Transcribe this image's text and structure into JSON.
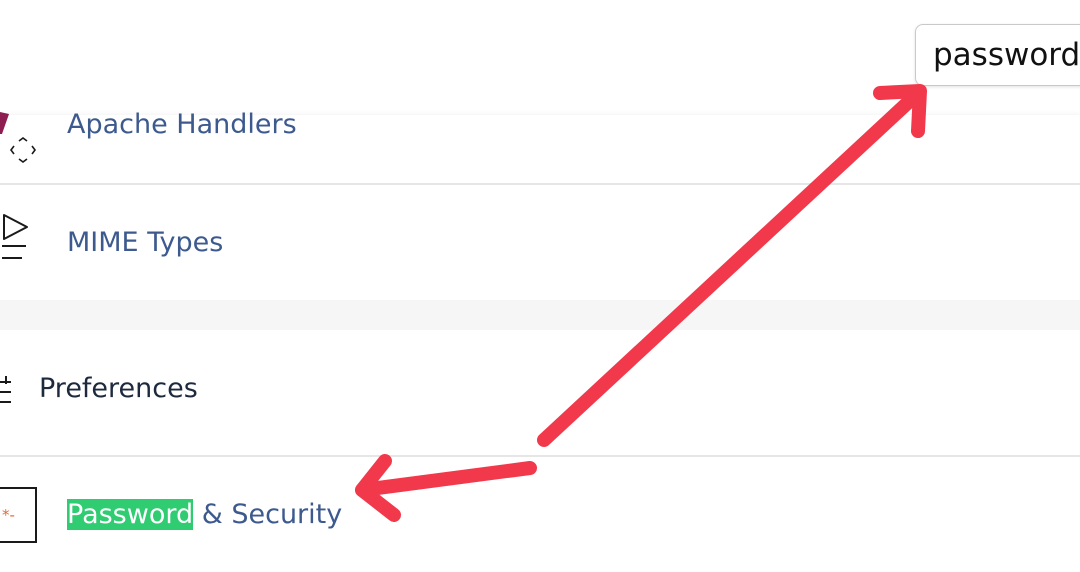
{
  "search": {
    "value": "password"
  },
  "items": {
    "apache_handlers": {
      "label": "Apache Handlers",
      "icon": "apache-handlers-icon"
    },
    "mime_types": {
      "label": "MIME Types",
      "icon": "mime-types-icon"
    }
  },
  "preferences": {
    "heading": "Preferences",
    "icon": "preferences-icon",
    "password_security": {
      "highlight": "Password",
      "rest": " & Security",
      "icon": "password-security-icon"
    }
  },
  "colors": {
    "link": "#3d5a8f",
    "heading": "#1d2a3e",
    "highlight": "#2fcc71",
    "arrow": "#f2394b"
  }
}
